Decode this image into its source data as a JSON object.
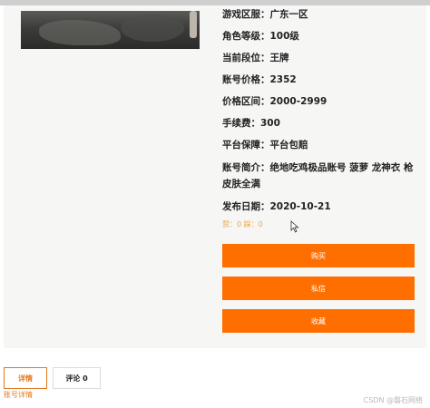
{
  "details": {
    "rows": [
      {
        "label": "游戏区服：",
        "value": "广东一区"
      },
      {
        "label": "角色等级：",
        "value": "100级"
      },
      {
        "label": "当前段位：",
        "value": "王牌"
      },
      {
        "label": "账号价格：",
        "value": "2352"
      },
      {
        "label": "价格区间：",
        "value": "2000-2999"
      },
      {
        "label": "手续费：",
        "value": "300"
      },
      {
        "label": "平台保障：",
        "value": "平台包赔"
      },
      {
        "label": "账号简介：",
        "value": "绝地吃鸡极品账号 菠萝 龙神衣 枪皮肤全满"
      },
      {
        "label": "发布日期：",
        "value": "2020-10-21"
      }
    ],
    "likes_text": "赞：0 踩：0"
  },
  "actions": {
    "buy_label": "购买",
    "message_label": "私信",
    "favorite_label": "收藏"
  },
  "tabs": {
    "details_label": "详情",
    "comments_label": "评论 0",
    "details_content": "账号详情"
  },
  "watermark": "CSDN @磐石网络",
  "colors": {
    "accent": "#ff6f00",
    "tab_active": "#e07a1f"
  }
}
